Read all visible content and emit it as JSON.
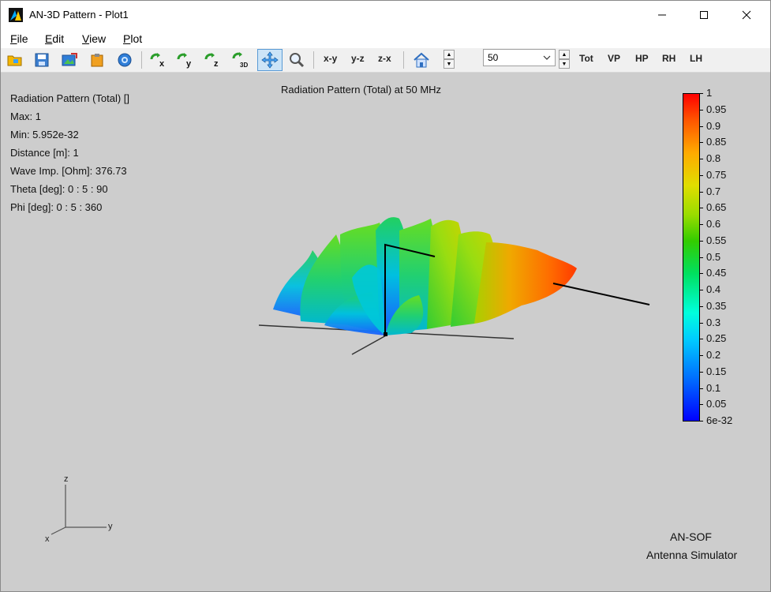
{
  "window": {
    "title": "AN-3D Pattern - Plot1",
    "controls": {
      "minimize": "—",
      "maximize": "☐",
      "close": "✕"
    }
  },
  "menu": [
    "File",
    "Edit",
    "View",
    "Plot"
  ],
  "toolbar": {
    "rotate_x": "x",
    "rotate_y": "y",
    "rotate_z": "z",
    "rotate_3d": "3D",
    "view_xy": "x-y",
    "view_yz": "y-z",
    "view_zx": "z-x",
    "frequency_value": "50",
    "tot": "Tot",
    "vp": "VP",
    "hp": "HP",
    "rh": "RH",
    "lh": "LH"
  },
  "info": [
    "Radiation Pattern (Total) []",
    "Max: 1",
    "Min: 5.952e-32",
    "Distance [m]: 1",
    "Wave Imp. [Ohm]: 376.73",
    "Theta [deg]: 0 : 5 : 90",
    "Phi [deg]: 0 : 5 : 360"
  ],
  "plot_title": "Radiation Pattern (Total) at 50 MHz",
  "colorbar_labels": [
    "1",
    "0.95",
    "0.9",
    "0.85",
    "0.8",
    "0.75",
    "0.7",
    "0.65",
    "0.6",
    "0.55",
    "0.5",
    "0.45",
    "0.4",
    "0.35",
    "0.3",
    "0.25",
    "0.2",
    "0.15",
    "0.1",
    "0.05",
    "6e-32"
  ],
  "triad": {
    "z": "z",
    "y": "y",
    "x": "x"
  },
  "brand": {
    "line1": "AN-SOF",
    "line2": "Antenna Simulator"
  }
}
